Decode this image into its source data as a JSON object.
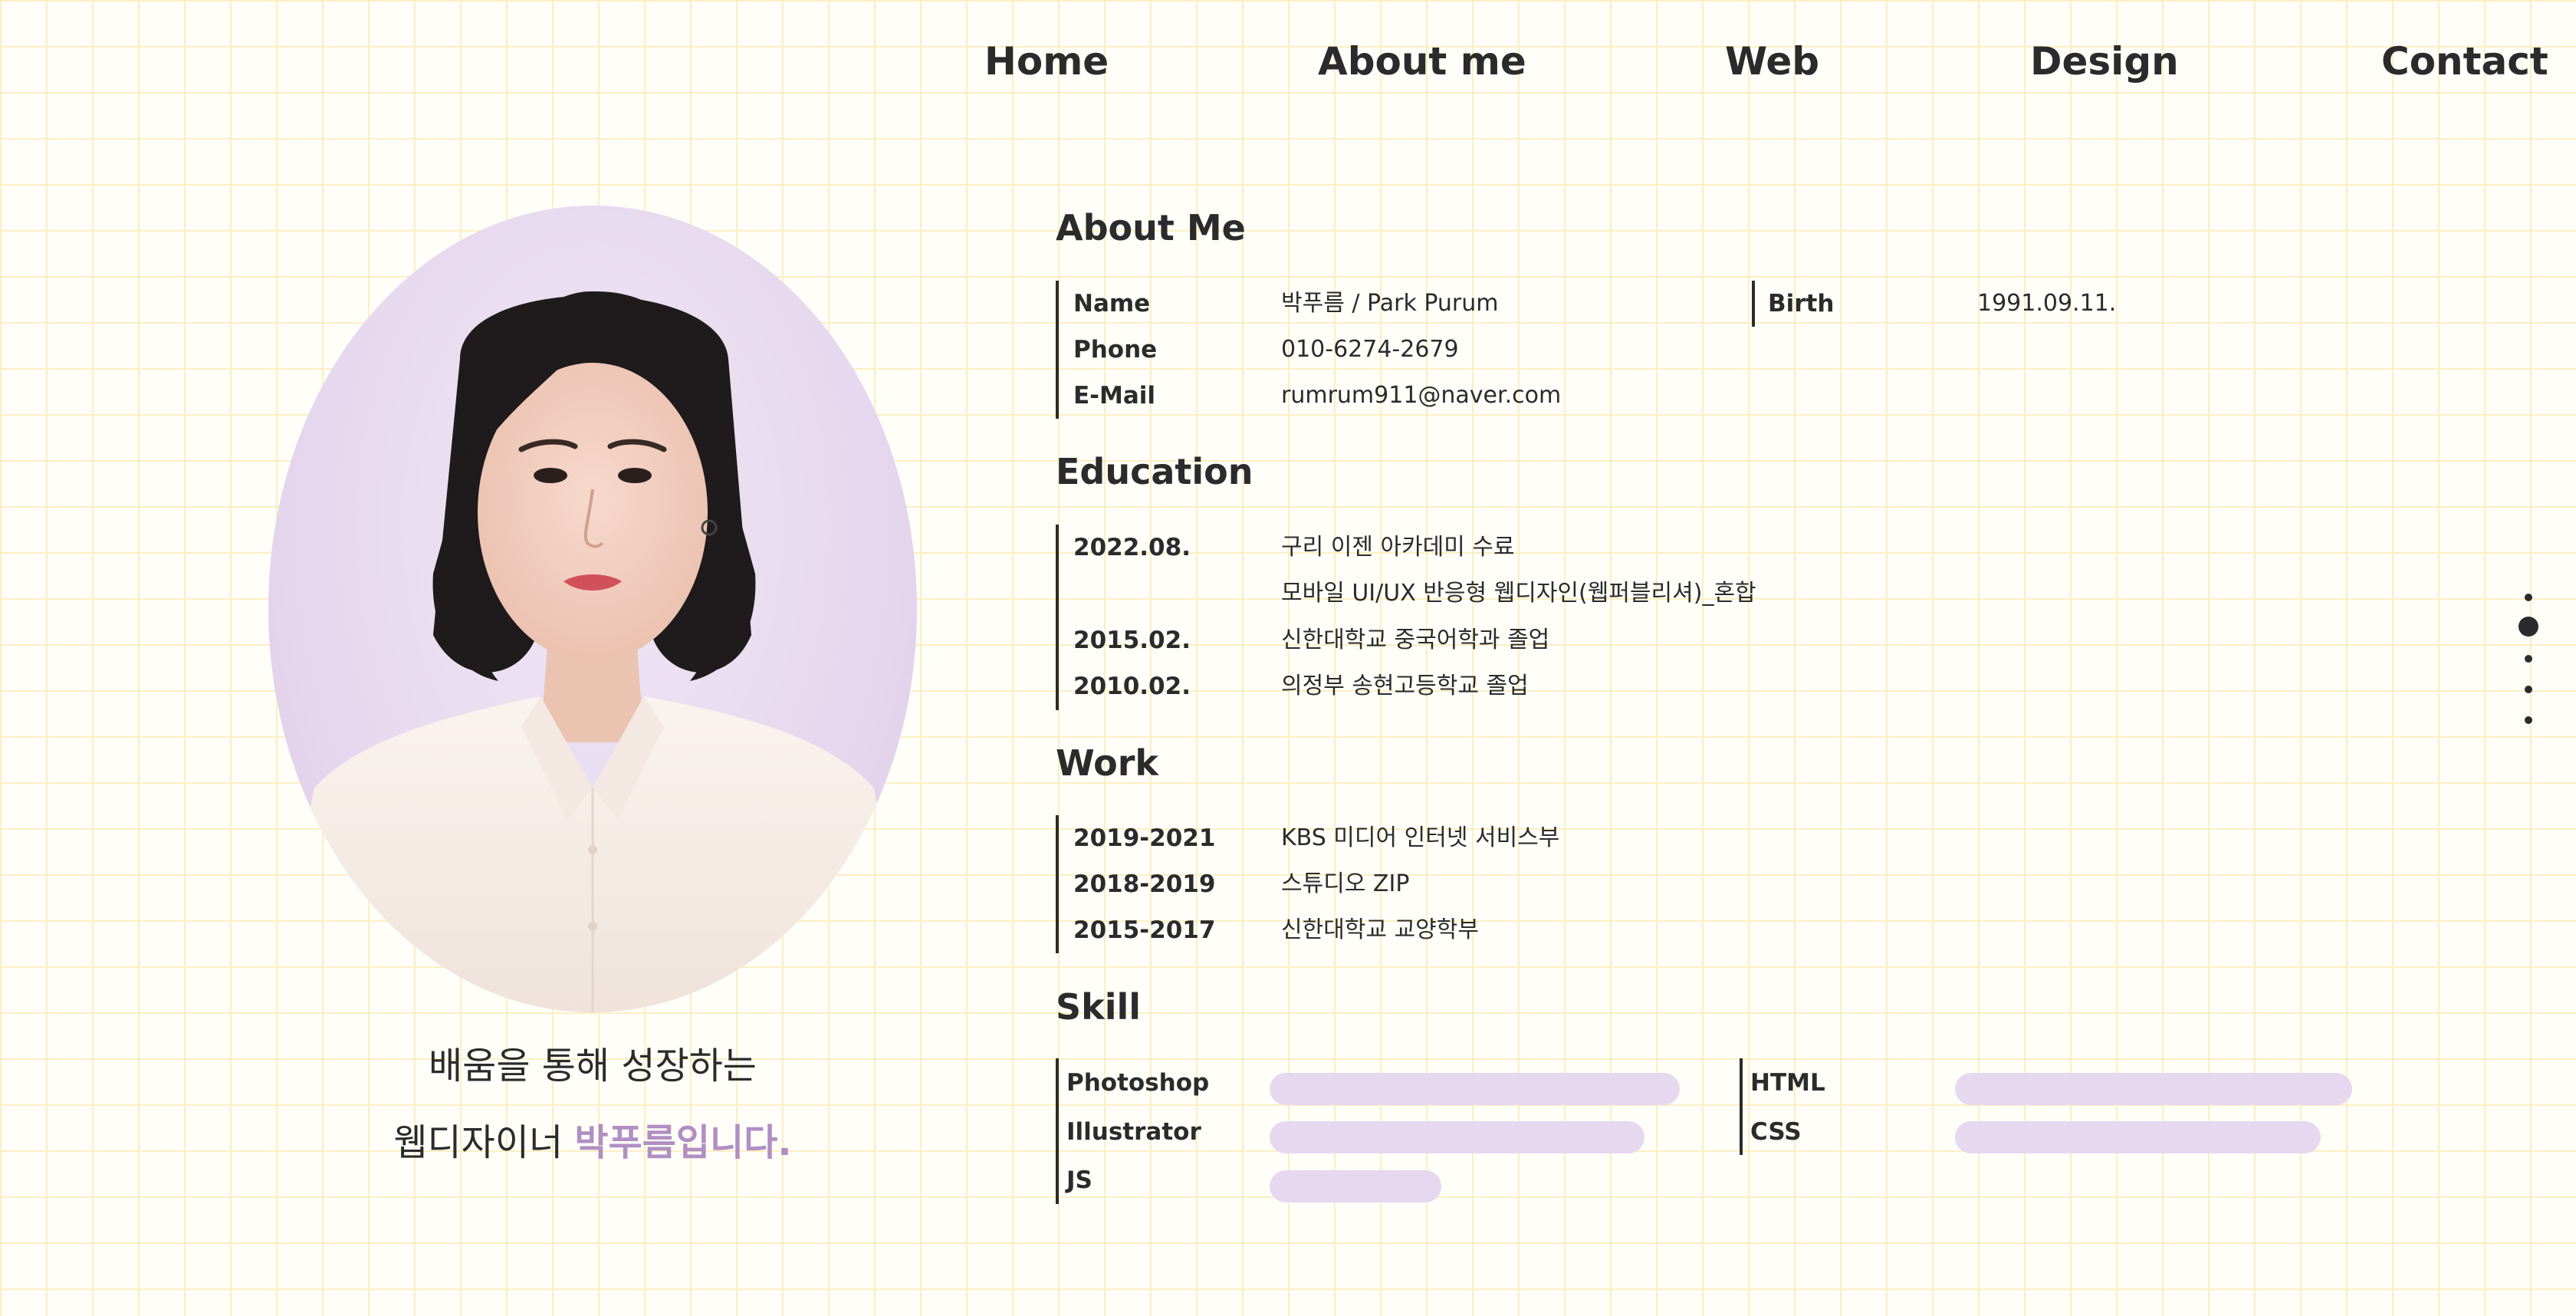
{
  "nav": {
    "home": "Home",
    "about": "About me",
    "web": "Web",
    "design": "Design",
    "contact": "Contact"
  },
  "tagline": {
    "line1": "배움을 통해 성장하는",
    "line2_prefix": "웹디자이너 ",
    "line2_accent": "박푸름입니다."
  },
  "about": {
    "title": "About Me",
    "rows": [
      {
        "label": "Name",
        "value": "박푸름 / Park Purum"
      },
      {
        "label": "Phone",
        "value": "010-6274-2679"
      },
      {
        "label": "E-Mail",
        "value": "rumrum911@naver.com"
      }
    ],
    "birth": {
      "label": "Birth",
      "value": "1991.09.11."
    }
  },
  "education": {
    "title": "Education",
    "rows": [
      {
        "label": "2022.08.",
        "value": "구리 이젠 아카데미 수료"
      },
      {
        "label": "",
        "value": "모바일 UI/UX 반응형 웹디자인(웹퍼블리셔)_혼합"
      },
      {
        "label": "2015.02.",
        "value": "신한대학교 중국어학과 졸업"
      },
      {
        "label": "2010.02.",
        "value": "의정부 송현고등학교 졸업"
      }
    ]
  },
  "work": {
    "title": "Work",
    "rows": [
      {
        "label": "2019-2021",
        "value": "KBS 미디어 인터넷 서비스부"
      },
      {
        "label": "2018-2019",
        "value": "스튜디오 ZIP"
      },
      {
        "label": "2015-2017",
        "value": "신한대학교 교양학부"
      }
    ]
  },
  "skill": {
    "title": "Skill",
    "left": [
      {
        "name": "Photoshop",
        "level": 0.93
      },
      {
        "name": "Illustrator",
        "level": 0.85
      },
      {
        "name": "JS",
        "level": 0.39
      }
    ],
    "right": [
      {
        "name": "HTML",
        "level": 0.9
      },
      {
        "name": "CSS",
        "level": 0.83
      }
    ],
    "bar_color": "#e6d8ef"
  },
  "page_indicator": {
    "count": 5,
    "active_index": 1
  },
  "colors": {
    "accent": "#b08fc3",
    "text": "#2b2b2b",
    "grid_line": "#fbefc3",
    "portrait_bg": "#e6d8ee"
  }
}
